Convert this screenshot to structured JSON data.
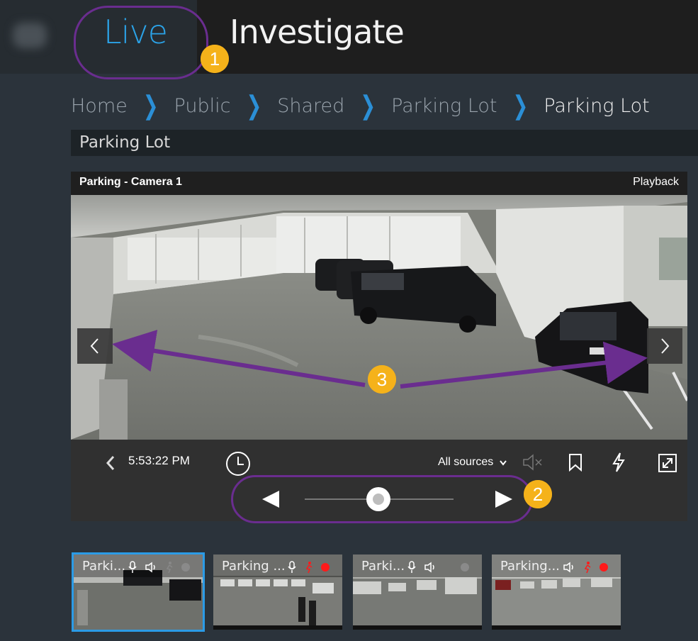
{
  "header": {
    "tab_live": "Live",
    "tab_investigate": "Investigate",
    "accent": "#2ba3e8"
  },
  "breadcrumb": [
    "Home",
    "Public",
    "Shared",
    "Parking Lot",
    "Parking Lot"
  ],
  "page_title": "Parking Lot",
  "video": {
    "camera_name": "Parking - Camera 1",
    "mode": "Playback",
    "time": "5:53:22 PM",
    "sources_label": "All sources"
  },
  "callouts": [
    "1",
    "2",
    "3"
  ],
  "thumbnails": [
    {
      "label": "Parki...",
      "recording": false,
      "motion": false
    },
    {
      "label": "Parking ...",
      "recording": true,
      "motion": true
    },
    {
      "label": "Parki...",
      "recording": false,
      "motion": false
    },
    {
      "label": "Parking...",
      "recording": true,
      "motion": true
    }
  ],
  "colors": {
    "callout": "#f5b21a",
    "highlight_ring": "#6a2d8f",
    "selected_thumb": "#2b9be6",
    "recording": "#ff1a1a"
  }
}
